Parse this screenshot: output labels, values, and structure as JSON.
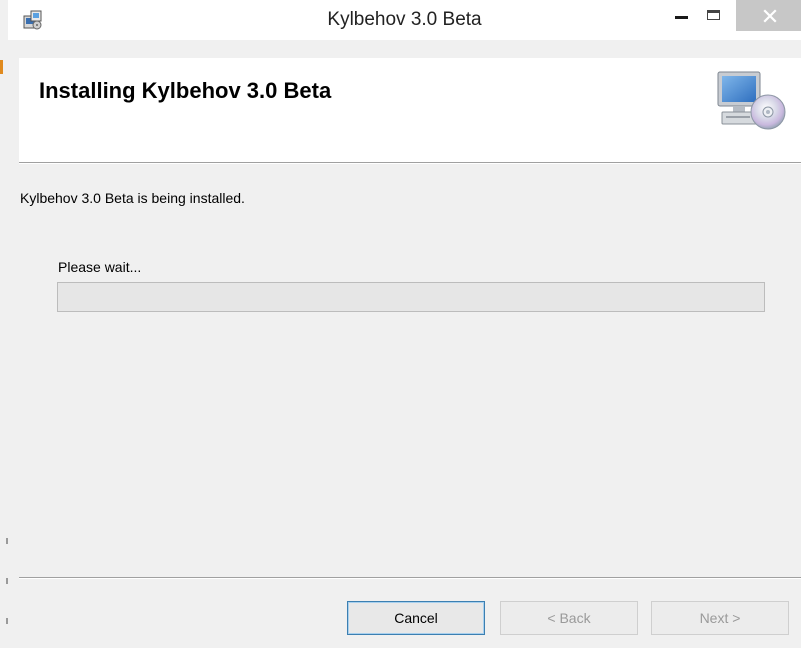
{
  "window": {
    "title": "Kylbehov 3.0 Beta",
    "minimize_glyph": "—",
    "maximize_glyph": "□",
    "close_glyph": "✕"
  },
  "header": {
    "title": "Installing Kylbehov 3.0 Beta",
    "icon": "computer-disc-icon"
  },
  "body": {
    "status_text": "Kylbehov 3.0 Beta is being installed.",
    "wait_label": "Please wait...",
    "progress_fraction": 0.0
  },
  "buttons": {
    "cancel": "Cancel",
    "back": "< Back",
    "next": "Next >"
  },
  "colors": {
    "progress_fill": "#06b025",
    "close_button": "#c7c7c7",
    "focus_border": "#3c7fb1"
  }
}
